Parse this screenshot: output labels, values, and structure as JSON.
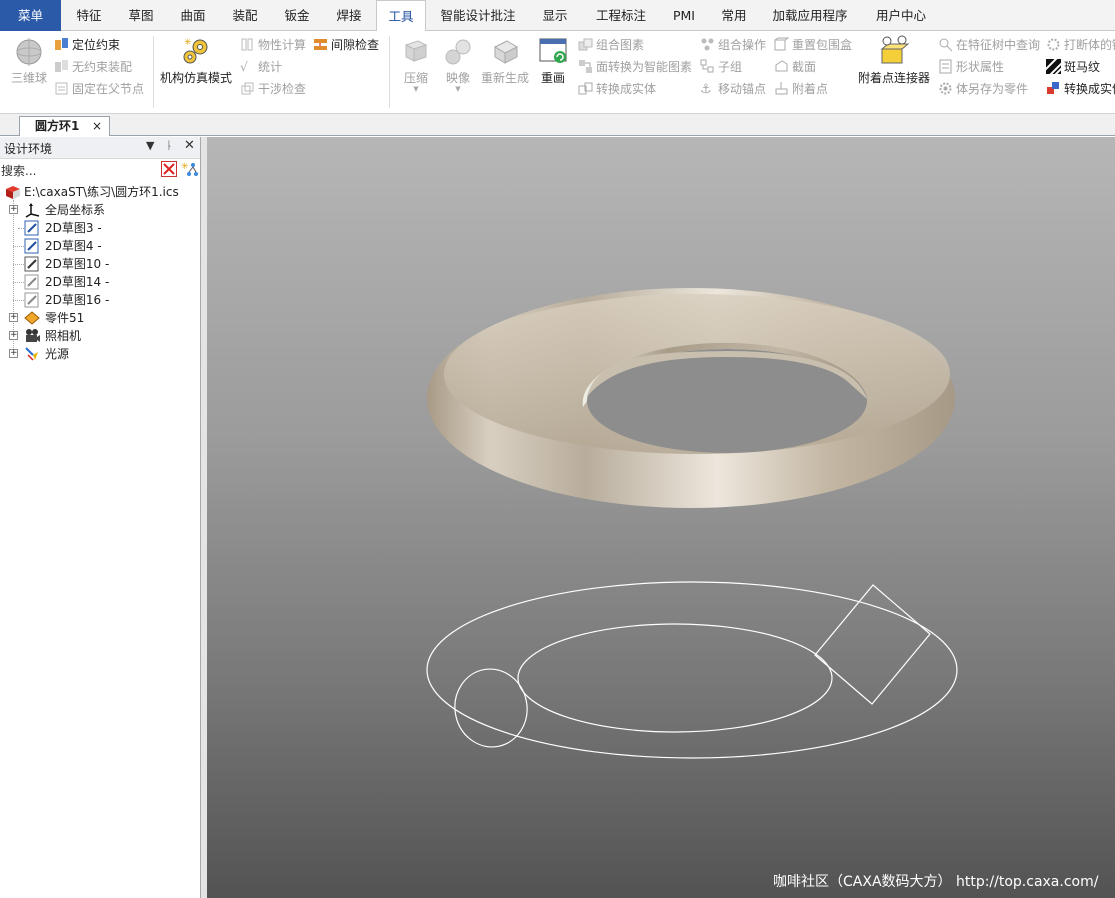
{
  "menubar": {
    "tabs": [
      {
        "label": "菜单"
      },
      {
        "label": "特征"
      },
      {
        "label": "草图"
      },
      {
        "label": "曲面"
      },
      {
        "label": "装配"
      },
      {
        "label": "钣金"
      },
      {
        "label": "焊接"
      },
      {
        "label": "工具"
      },
      {
        "label": "智能设计批注"
      },
      {
        "label": "显示"
      },
      {
        "label": "工程标注"
      },
      {
        "label": "PMI"
      },
      {
        "label": "常用"
      },
      {
        "label": "加载应用程序"
      },
      {
        "label": "用户中心"
      }
    ],
    "active": "工具"
  },
  "ribbon": {
    "sphere": "三维球",
    "pos_constraint": "定位约束",
    "free_assembly": "无约束装配",
    "fix_parent": "固定在父节点",
    "mech_sim": "机构仿真模式",
    "mass_props": "物性计算",
    "stats": "统计",
    "interference": "干涉检查",
    "clearance": "间隙检查",
    "compress": "压缩",
    "mirror_map": "映像",
    "regen": "重新生成",
    "redraw": "重画",
    "combine_shapes": "组合图素",
    "face_to_smart": "面转换为智能图素",
    "to_solid": "转换成实体",
    "combine_op": "组合操作",
    "subgroup": "子组",
    "move_anchor": "移动锚点",
    "reset_bbox": "重置包围盒",
    "section": "截面",
    "attach_point": "附着点",
    "attach_connector": "附着点连接器",
    "query_tree": "在特征树中查询",
    "shape_props": "形状属性",
    "save_as_part": "体另存为零件",
    "break_link": "打断体的链接",
    "zebra": "斑马纹",
    "convert_to": "转换成实体"
  },
  "document": {
    "tab_label": "圆方环1",
    "close_glyph": "×"
  },
  "design_env": {
    "title": "设计环境",
    "search_placeholder": "搜索...",
    "root": "E:\\caxaST\\练习\\圆方环1.ics",
    "items": [
      {
        "label": "全局坐标系",
        "icon": "axes-icon",
        "expander": "+"
      },
      {
        "label": "2D草图3 -",
        "icon": "sketch-icon",
        "expander": ""
      },
      {
        "label": "2D草图4 -",
        "icon": "sketch-icon",
        "expander": ""
      },
      {
        "label": "2D草图10 -",
        "icon": "sketch-icon",
        "expander": ""
      },
      {
        "label": "2D草图14 -",
        "icon": "sketch-icon",
        "expander": ""
      },
      {
        "label": "2D草图16 -",
        "icon": "sketch-icon",
        "expander": ""
      },
      {
        "label": "零件51",
        "icon": "part-icon",
        "expander": "+"
      },
      {
        "label": "照相机",
        "icon": "camera-icon",
        "expander": "+"
      },
      {
        "label": "光源",
        "icon": "light-icon",
        "expander": "+"
      }
    ]
  },
  "viewport": {
    "watermark": "咖啡社区（CAXA数码大方） http://top.caxa.com/"
  },
  "colors": {
    "menu_blue": "#2b5aa8",
    "ring_surface": "#cbbfae",
    "wire": "#ffffff"
  }
}
